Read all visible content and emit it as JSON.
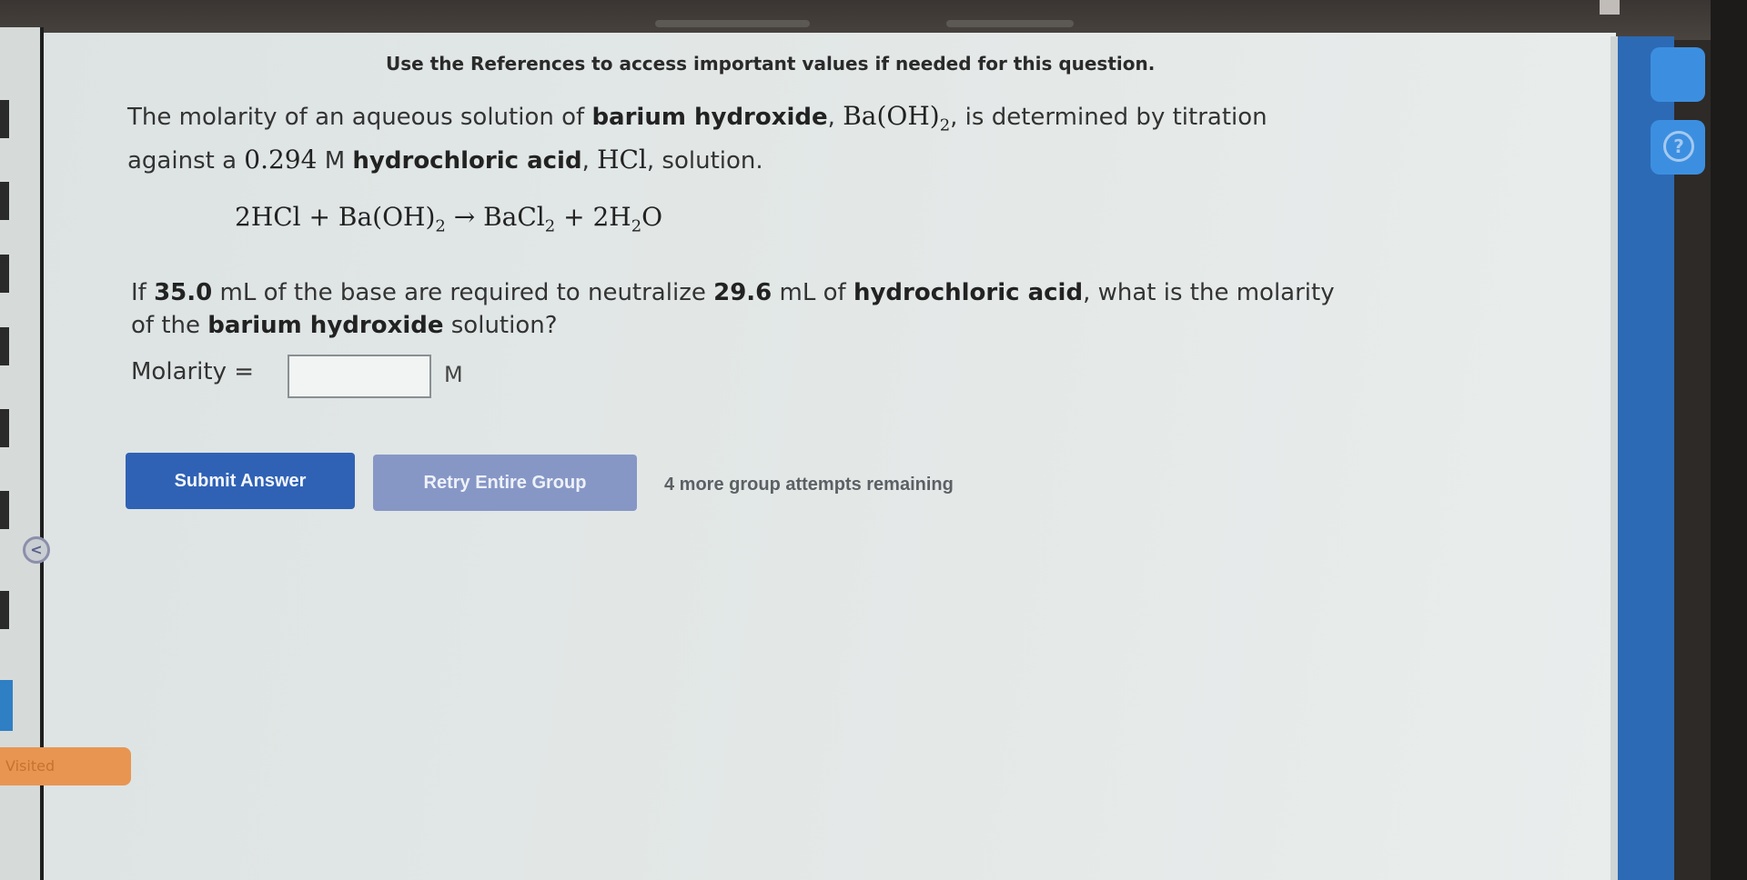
{
  "question": {
    "references_note": "Use the References to access important values if needed for this question.",
    "intro": {
      "t1": "The molarity of an aqueous solution of ",
      "base_name": "barium hydroxide",
      "t2": ", ",
      "base_formula_main": "Ba(OH)",
      "base_formula_sub": "2",
      "t3": ", is determined by titration",
      "t4": "against a ",
      "acid_conc": "0.294",
      "acid_unit": " M ",
      "acid_name": "hydrochloric acid",
      "t5": ", ",
      "acid_formula": "HCl",
      "t6": ", solution."
    },
    "equation": {
      "lhs1": "2HCl + Ba(OH)",
      "lhs1_sub": "2",
      "arrow": " → ",
      "rhs1": "BaCl",
      "rhs1_sub": "2",
      "rhs2": " + 2H",
      "rhs2_sub": "2",
      "rhs3": "O"
    },
    "prompt": {
      "p1": "If ",
      "base_volume": "35.0",
      "p2": " mL of the base are required to neutralize ",
      "acid_volume": "29.6",
      "p3": " mL of ",
      "acid_name": "hydrochloric acid",
      "p4": ", what is the molarity",
      "p5": "of the ",
      "base_name": "barium hydroxide",
      "p6": " solution?"
    },
    "answer": {
      "label": "Molarity =",
      "value": "",
      "unit": "M"
    }
  },
  "actions": {
    "submit_label": "Submit Answer",
    "retry_label": "Retry Entire Group",
    "attempts_text": "4 more group attempts remaining"
  },
  "sidebar": {
    "back_symbol": "<",
    "visited_label": "Visited",
    "help_symbol": "?"
  },
  "colors": {
    "submit_button": "#2f62b5",
    "retry_button": "#8697c6",
    "right_rail": "#2c6ab5",
    "visited_tag": "#e89552"
  }
}
